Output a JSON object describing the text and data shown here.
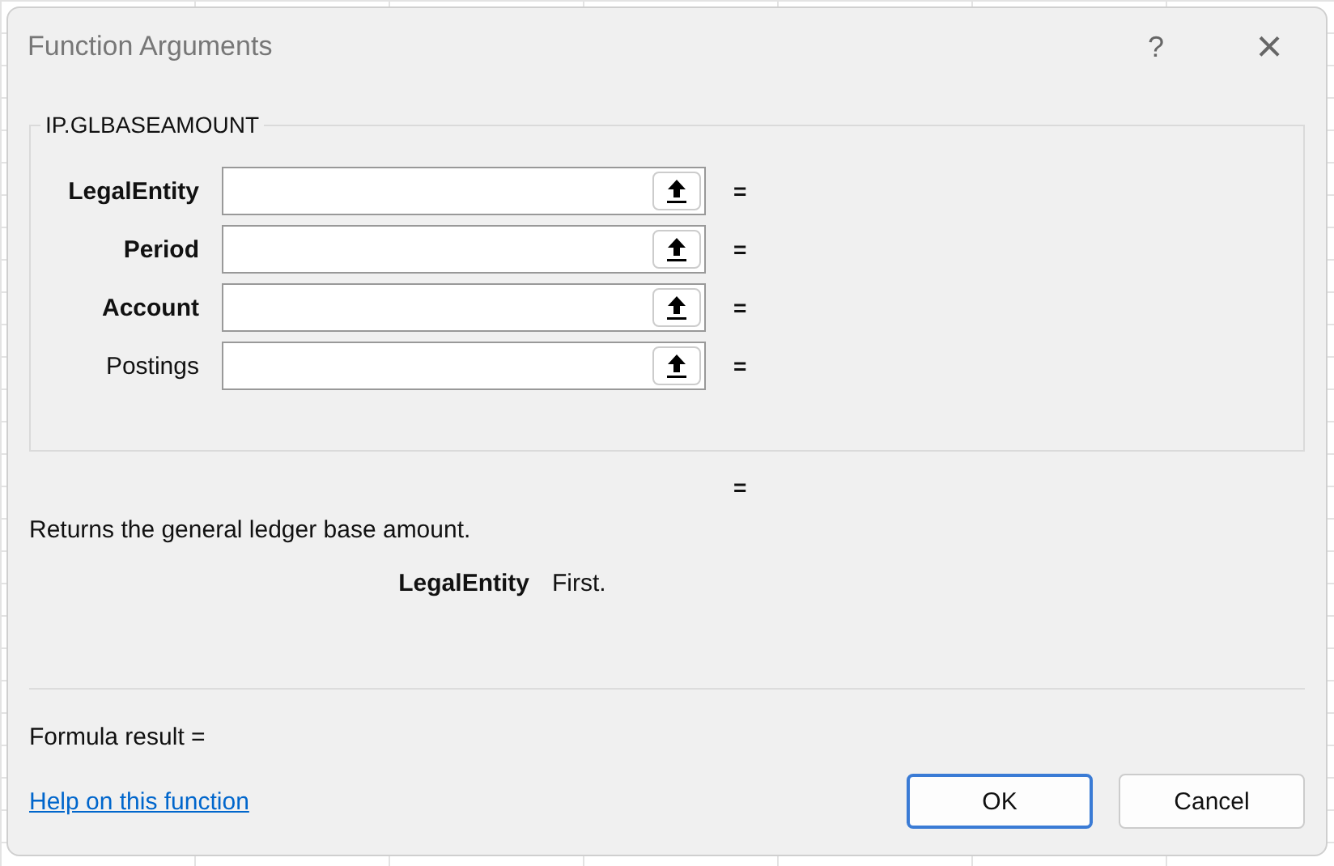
{
  "window": {
    "title": "Function Arguments",
    "help": "?",
    "close": "×"
  },
  "function_group": {
    "name": "IP.GLBASEAMOUNT",
    "arguments": [
      {
        "label": "LegalEntity",
        "required": true,
        "result": "="
      },
      {
        "label": "Period",
        "required": true,
        "result": "="
      },
      {
        "label": "Account",
        "required": true,
        "result": "="
      },
      {
        "label": "Postings",
        "required": false,
        "result": "="
      }
    ]
  },
  "function_result": "=",
  "description": "Returns the general ledger base amount.",
  "argument_help": {
    "name": "LegalEntity",
    "text": "First."
  },
  "formula_result": "Formula result =",
  "help_link": "Help on this function",
  "buttons": [
    {
      "label": "OK",
      "default": true
    },
    {
      "label": "Cancel",
      "default": false
    }
  ]
}
